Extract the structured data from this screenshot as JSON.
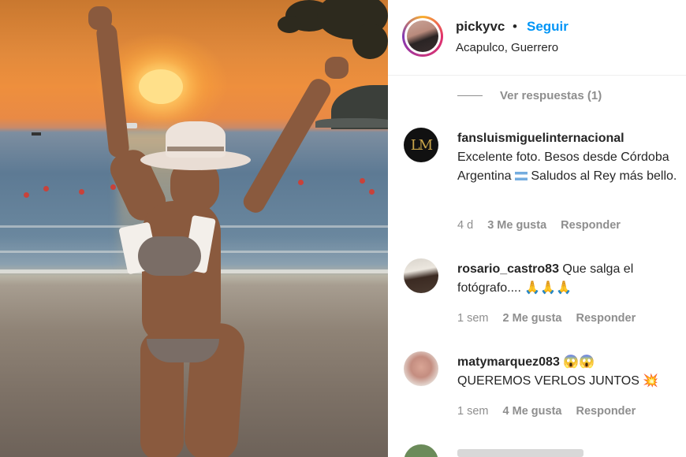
{
  "post": {
    "username": "pickyvc",
    "dot": "•",
    "follow_label": "Seguir",
    "location": "Acapulco, Guerrero",
    "view_replies": "Ver respuestas (1)"
  },
  "comments": [
    {
      "username": "fansluismiguelinternacional",
      "text_a": "Excelente foto. Besos desde Córdoba Argentina ",
      "text_b": " Saludos al Rey más bello.",
      "avatar_text": "LM",
      "time": "4 d",
      "likes": "3 Me gusta",
      "reply": "Responder"
    },
    {
      "username": "rosario_castro83",
      "text": " Que salga el fotógrafo.... 🙏🙏🙏",
      "time": "1 sem",
      "likes": "2 Me gusta",
      "reply": "Responder"
    },
    {
      "username": "matymarquez083",
      "emoji": " 😱😱",
      "text": "QUEREMOS VERLOS JUNTOS 💥",
      "time": "1 sem",
      "likes": "4 Me gusta",
      "reply": "Responder"
    }
  ],
  "colors": {
    "follow_blue": "#0095f6",
    "meta_gray": "#8e8e8e",
    "text_dark": "#262626"
  }
}
